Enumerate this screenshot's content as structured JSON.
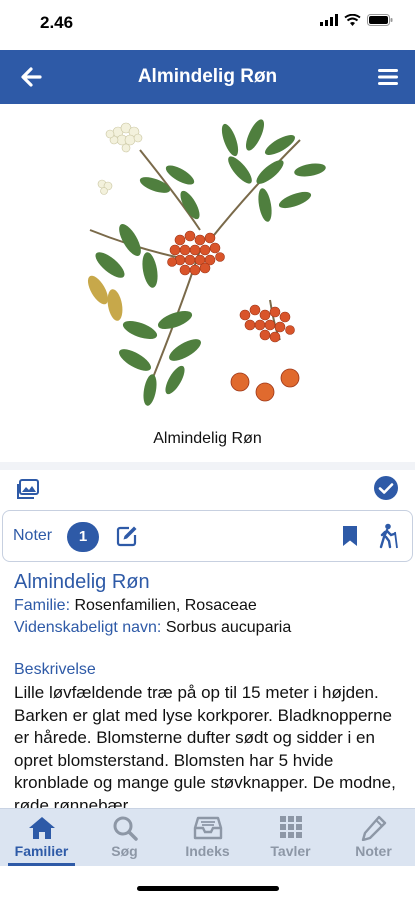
{
  "status_bar": {
    "time": "2.46"
  },
  "header": {
    "title": "Almindelig Røn",
    "back_icon": "back-arrow-icon",
    "menu_icon": "hamburger-menu-icon",
    "background": "#2e5aa7"
  },
  "image": {
    "caption": "Almindelig Røn"
  },
  "notes": {
    "label": "Noter",
    "count": "1"
  },
  "species": {
    "name": "Almindelig Røn",
    "family_label": "Familie:",
    "family_value": "Rosenfamilien, Rosaceae",
    "scientific_label": "Videnskabeligt navn:",
    "scientific_value": "Sorbus aucuparia",
    "description_heading": "Beskrivelse",
    "description": "Lille løvfældende træ på op til 15 meter i højden. Barken er glat med lyse korkporer. Bladknopperne er hårede. Blomsterne dufter sødt og sidder i en opret blomsterstand. Blomsten har 5 hvide kronblade og mange gule støvknapper. De modne, røde rønnebær"
  },
  "tabs": [
    {
      "label": "Familier",
      "icon": "home-icon",
      "active": true
    },
    {
      "label": "Søg",
      "icon": "search-icon",
      "active": false
    },
    {
      "label": "Indeks",
      "icon": "inbox-icon",
      "active": false
    },
    {
      "label": "Tavler",
      "icon": "grid-icon",
      "active": false
    },
    {
      "label": "Noter",
      "icon": "pencil-icon",
      "active": false
    }
  ],
  "colors": {
    "accent": "#2e5aa7",
    "tab_inactive": "#8d97a6",
    "tab_bar": "#dbe4f1"
  }
}
